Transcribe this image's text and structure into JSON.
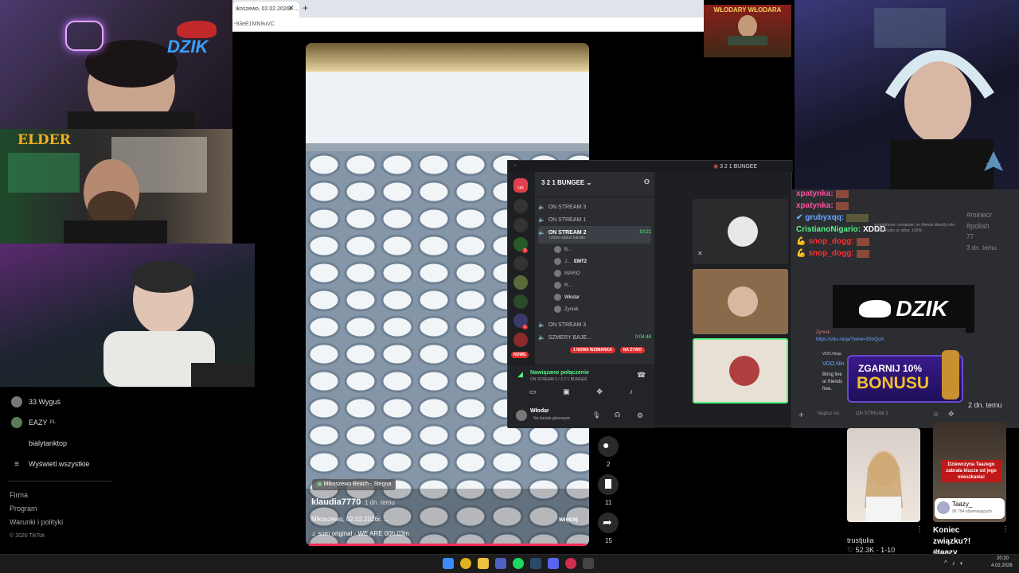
{
  "browser": {
    "tab_title": "ikoszewo, 02.02.2026r. ...",
    "url_text": "-93eE1MN9uVC"
  },
  "tiktok_sidebar": {
    "following": [
      "33 Wyguś",
      "EAZY",
      "bialytanktop"
    ],
    "eazy_badge": "PL",
    "show_all": "Wyświetl wszystkie",
    "footer_links": [
      "Firma",
      "Program",
      "Warunki i polityki"
    ],
    "copyright": "© 2026 TikTok"
  },
  "video": {
    "location_tag": "Mikoszewo Beach - Stegna",
    "author": "klaudia7770",
    "time_ago": "1 dn. temu",
    "description": "Mikoszewo, 02.02.2026r. ...",
    "more": "więcej",
    "music": "som original - WE ARE 00h.03m"
  },
  "actions": {
    "comments": "2",
    "bookmarks": "11",
    "shares": "15"
  },
  "discord": {
    "titlebar": "3 2 1 BUNGEE",
    "server_name": "3 2 1 BUNGEE",
    "home_badge": "685",
    "server_badge_1": "3",
    "server_badge_2": "1",
    "new_label": "NOWE",
    "channels": [
      "ON STREAM 3",
      "ON STREAM 1",
      "ON STREAM 2"
    ],
    "active_time": "10:21",
    "active_status": "Ustaw status kanału",
    "users": [
      "B...",
      "J...",
      "MARIO",
      "R...",
      "Włodar",
      "Zyniak"
    ],
    "emt2": "EMT2",
    "channels_2": [
      "ON STREAM 3",
      "SZMERY BAJE..."
    ],
    "time_2": "0:04:48",
    "mention": "1 NOWA WZMIANKA",
    "live": "NA ŻYWO",
    "voice_connected": "Nawiązano połączenie",
    "voice_channel": "ON STREAM 2 / 3 2 1 BUNGEE",
    "me_name": "Włodar",
    "me_status": "Na kanale głosowym",
    "message_placeholder": "Napisz na",
    "message_channel": "ON STREAM 2"
  },
  "chat": {
    "lines": [
      {
        "user": "xpatynka:",
        "text": "",
        "color": "#ff4fa3"
      },
      {
        "user": "xpatynka:",
        "text": "",
        "color": "#ff4fa3"
      },
      {
        "user": "grubyxqq:",
        "text": "",
        "color": "#6aa8ff"
      },
      {
        "user": "CristianoNigario:",
        "text": "XDDD",
        "color": "#57f287"
      },
      {
        "user": "snop_dogg:",
        "text": "",
        "color": "#ff3030"
      },
      {
        "user": "snop_dogg:",
        "text": "",
        "color": "#ff3030"
      }
    ],
    "overlap_hashtags": [
      "#minecr",
      "#polish",
      "77",
      "3 dn. temu"
    ],
    "overlap_faint": "smartphone, computer, on friends directly into OBS Studio or other. 100%",
    "vdo_name": "VDO.Ninja",
    "vdo_link": "VDO.Nin",
    "vdo_body": [
      "Bring live",
      "or friends",
      "free."
    ],
    "vdo_url": "https://vdo.ninja/?view=3SnQuX",
    "zyniak": "Zyniak"
  },
  "promo": {
    "brand": "DZIK",
    "line1": "ZGARNIJ 10%",
    "line2": "BONUSU"
  },
  "overlay_logos": {
    "dzik_small": "DZIK",
    "elder": "ELDER",
    "wlodary": "WŁODARY WŁODARA"
  },
  "suggested": [
    {
      "user": "trustjulia",
      "stats": "52.3K · 1-10"
    },
    {
      "title": "Koniec związku?! #taazy",
      "user": "taazy",
      "sub_user": "Taazy_",
      "sub_stats": "96 794 obserwujących",
      "overlay": "Dziewczyna Taazego zabrała klucze od jego mieszkania!"
    }
  ],
  "side_time": "2 dn. temu",
  "taskbar": {
    "time": "20:20",
    "date": "4.02.2026"
  }
}
